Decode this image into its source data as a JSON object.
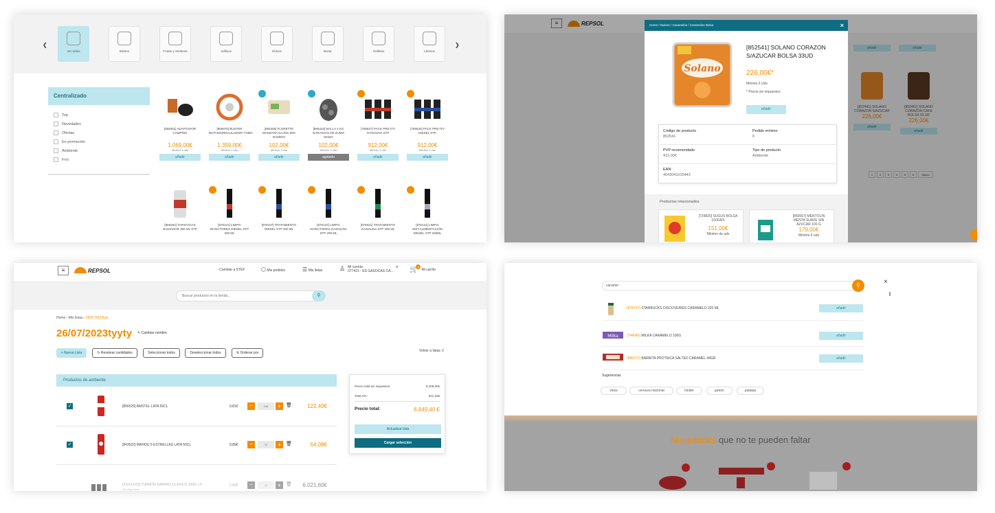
{
  "p1": {
    "categories": [
      "Ver todos",
      "Butano",
      "Frutas y Verduras",
      "Aditivos",
      "Dulces",
      "Bazar",
      "Galletas",
      "Lácteos"
    ],
    "sidebar_title": "Centralizado",
    "filters": [
      "Top",
      "Novedades",
      "Ofertas",
      "En promoción",
      "Ambiente",
      "Frío"
    ],
    "products_row1": [
      {
        "name": "[859301] ADAPTADOR CAMPING",
        "price": "1.069,00€",
        "min": "Mínimo 1 uds",
        "btn": "añadir"
      },
      {
        "name": "[866976] BUSTER BUTANO(REGULADOR+TUBO",
        "price": "1.359,00€",
        "min": "Mínimo 1 uds",
        "btn": "añadir"
      },
      {
        "name": "[892256] FLORETTE MANZANA GAJOS 60G RAMINO",
        "price": "102,00€",
        "min": "Mínimo 1 uds",
        "btn": "añadir"
      },
      {
        "name": "[865434] MALLA 4 KG NARANJAS DE ZUMO MANO",
        "price": "102,00€",
        "min": "Mínimo 1 uds",
        "btn": "agotado"
      },
      {
        "name": "[765537] PACK PRE-ITV GASOLINA STP",
        "price": "912,00€",
        "min": "Mínimo 1 uds",
        "btn": "añadir"
      },
      {
        "name": "[765540] PACK PRE-ITV DIESEL STP",
        "price": "912,00€",
        "min": "Mínimo 1 uds",
        "btn": "añadir"
      }
    ],
    "products_row2": [
      {
        "name": "[866292] TAPAFUGAS RADIADOR 300 ML STP"
      },
      {
        "name": "[876121] LIMPIA INYECTORES DIESEL STP 200 ML"
      },
      {
        "name": "[876107] TRATAMIENTO DIESEL STP 200 ML"
      },
      {
        "name": "[876122] LIMPIA INYECTORES GASOLINA STP 200 ML"
      },
      {
        "name": "[876021] TRATAMIENTO GASOLINA STP 200 ML"
      },
      {
        "name": "[876124] LIMPIA SIST.ALIMENTACIÓN DIESEL STP 200ML"
      }
    ]
  },
  "p2": {
    "brand": "REPSOL",
    "breadcrumb": [
      "Home",
      "Dulces",
      "Caramelos",
      "Caramelos Bolsa"
    ],
    "close": "×",
    "title": "[852541] SOLANO CORAZON S/AZUCAR BOLSA 33UD",
    "price": "226,00€*",
    "min": "Mínimo 6 Uds",
    "note": "* Precio sin impuestos",
    "add": "añadir",
    "package_text": "Solano",
    "details": [
      {
        "label": "Código de producto",
        "value": "852541"
      },
      {
        "label": "Pedido mínimo",
        "value": "6"
      },
      {
        "label": "PVP recomendado",
        "value": "415,00€"
      },
      {
        "label": "Tipo de producto",
        "value": "Ambiente"
      },
      {
        "label": "EAN:",
        "value": "4043041010443"
      }
    ],
    "related_title": "Productos relacionados",
    "related": [
      {
        "name": "[729820] SUGUS BOLSA 150GRS",
        "price": "151,00€",
        "min": "Mínimo de uds"
      },
      {
        "name": "[850567] MENTOLIN MENTA SUAVE SIN AZUCAR 100 G",
        "price": "179,00€",
        "min": "Mínimo 6 uds"
      }
    ],
    "bg_products": [
      {
        "name": "[852441] SOLANO CORAZON S/AZUCAR",
        "price": "226,00€",
        "btn": "añadir"
      },
      {
        "name": "[852462] SOLANO CORAZON CAFE BOLSA 33 UD",
        "price": "226,00€",
        "btn": "añadir"
      }
    ],
    "pages": [
      "1",
      "2",
      "3",
      "4",
      "5",
      "6",
      "Último"
    ]
  },
  "p3": {
    "brand": "REPSOL",
    "nav": [
      "Cambiar a STEF",
      "Mis pedidos",
      "Mis listas",
      "Mi cuenta",
      "Mi carrito"
    ],
    "account_sub": "077421 - ES GASOCAS CA...",
    "cart_count": "0",
    "search_placeholder": "Buscar productos en la tienda...",
    "breadcrumb": [
      "Home",
      "Mis listas",
      "26/07/2023tyty"
    ],
    "title": "26/07/2023tyyty",
    "rename": "Cambiar nombre",
    "buttons": [
      "+ Nueva Lista",
      "Resetear cantidades",
      "Seleccionar todos",
      "Deseleccionar todos",
      "Ordenar por"
    ],
    "back": "Volver a listas",
    "section": "Productos de ambiente",
    "rows": [
      {
        "name": "[856529] AMSTEL LATA 50CL",
        "unit": "0,81€",
        "qty": "144",
        "total": "122,40€"
      },
      {
        "name": "[843522] MAHOU 5 ESTRELLAS LATA 50CL",
        "unit": "0,89€",
        "qty": "72",
        "total": "64,08€"
      },
      {
        "name": "[XXXXXXX] TURRÓN XABARO CLÁSICO 100G x 5",
        "unit": "2,80€",
        "qty": "15",
        "total": "6.021,60€",
        "note": "Sin disponible"
      }
    ],
    "summary": {
      "label1": "Precio total sin impuestos:",
      "val1": "6.208,00€",
      "label2": "Total IVA:",
      "val2": "641,32€",
      "label3": "Precio total:",
      "val3": "6.849,40 €",
      "update": "Actualizar lista",
      "load": "Cargar selección"
    }
  },
  "p4": {
    "query": "caramel",
    "results": [
      {
        "code": "(878707)",
        "name": "STARBUCKS DISCOVERIES CARAMELO 220 ML",
        "btn": "añadir"
      },
      {
        "code": "(744040)",
        "name": "MILKA CARAMELO 100G",
        "btn": "añadir"
      },
      {
        "code": "(886271)",
        "name": "BARRITA PROTEICA SALTED CARAMEL 44GR",
        "btn": "añadir"
      }
    ],
    "suggestions_title": "Sugerencias",
    "suggestions": [
      "vinos",
      "cerveza nacional",
      "kinder",
      "jamón",
      "patatas"
    ],
    "close": "×",
    "banner_a": "Novedades",
    "banner_b": "que no te pueden faltar",
    "milka_text": "Milka",
    "colors": {
      "orange": "#f28c00",
      "teal": "#0e6d82",
      "light": "#bde6ee"
    }
  }
}
